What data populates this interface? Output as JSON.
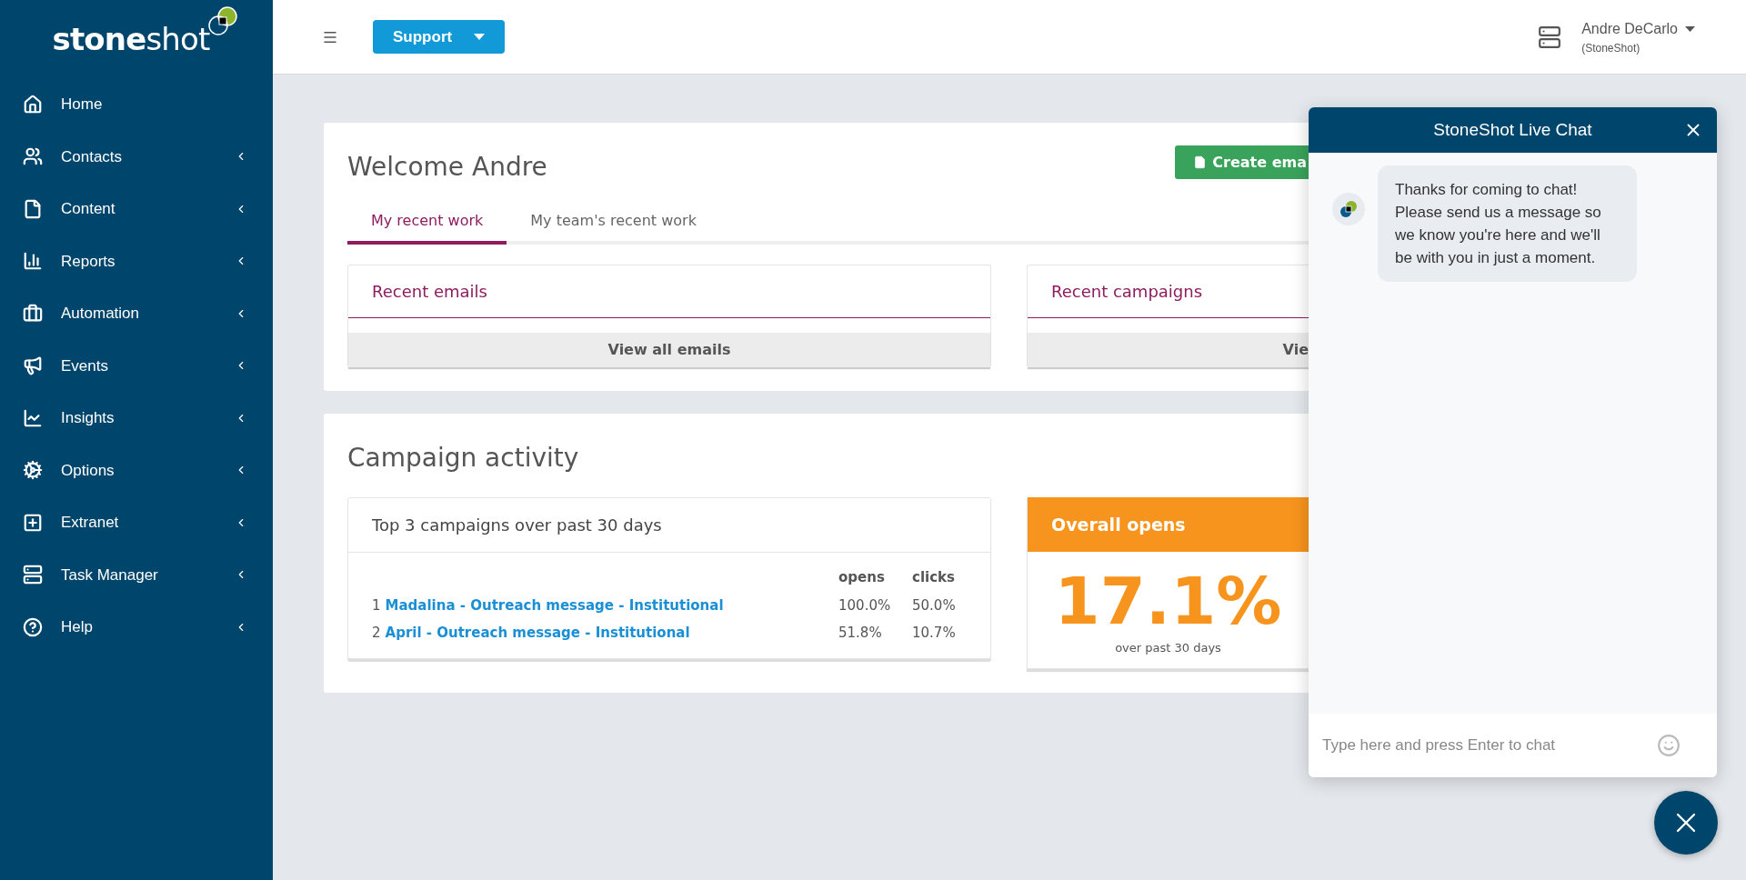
{
  "sidebar": {
    "logo_text": "**stone**shot",
    "items": [
      {
        "label": "Home",
        "has_submenu": false
      },
      {
        "label": "Contacts",
        "has_submenu": true
      },
      {
        "label": "Content",
        "has_submenu": true
      },
      {
        "label": "Reports",
        "has_submenu": true
      },
      {
        "label": "Automation",
        "has_submenu": true
      },
      {
        "label": "Events",
        "has_submenu": true
      },
      {
        "label": "Insights",
        "has_submenu": true
      },
      {
        "label": "Options",
        "has_submenu": true
      },
      {
        "label": "Extranet",
        "has_submenu": true
      },
      {
        "label": "Task Manager",
        "has_submenu": true
      },
      {
        "label": "Help",
        "has_submenu": true
      }
    ]
  },
  "header": {
    "support_button": "Support",
    "user_name": "Andre DeCarlo",
    "user_org": "(StoneShot)"
  },
  "welcome": {
    "title": "Welcome Andre",
    "create_button": "Create ema",
    "tabs": [
      {
        "label": "My recent work",
        "selected": true
      },
      {
        "label": "My team's recent work",
        "selected": false
      }
    ],
    "panels": [
      {
        "title": "Recent emails",
        "button": "View all emails"
      },
      {
        "title": "Recent campaigns",
        "button": "Vie"
      }
    ]
  },
  "activity": {
    "title": "Campaign activity",
    "top": {
      "title": "Top 3 campaigns over past 30 days",
      "columns": [
        "opens",
        "clicks"
      ],
      "rows": [
        {
          "rank": "1",
          "name": "Madalina - Outreach message - Institutional",
          "opens": "100.0%",
          "clicks": "50.0%"
        },
        {
          "rank": "2",
          "name": "April - Outreach message - Institutional",
          "opens": "51.8%",
          "clicks": "10.7%"
        }
      ]
    },
    "overall": {
      "title": "Overall opens",
      "value": "17.1%",
      "caption": "over past 30 days"
    }
  },
  "chat": {
    "title": "StoneShot Live Chat",
    "message": "Thanks for coming to chat! Please send us a message so we know you're here and we'll be with you in just a moment.",
    "placeholder": "Type here and press Enter to chat"
  }
}
